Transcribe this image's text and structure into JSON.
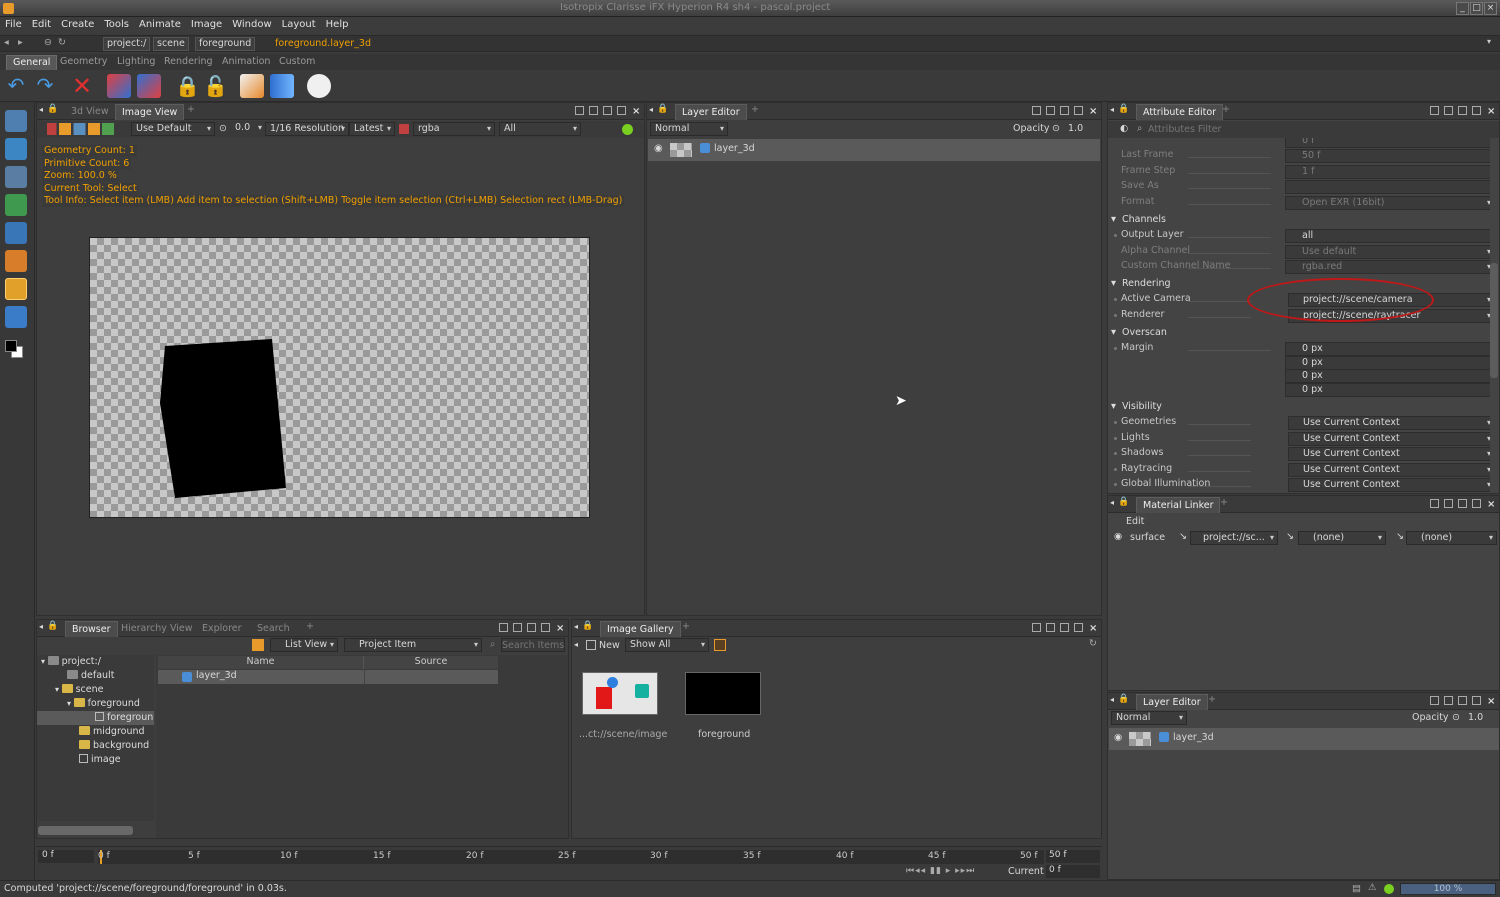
{
  "app": {
    "window_title": "Isotropix Clarisse iFX Hyperion R4 sh4 - pascal.project"
  },
  "menu": [
    "File",
    "Edit",
    "Create",
    "Tools",
    "Animate",
    "Image",
    "Window",
    "Layout",
    "Help"
  ],
  "address": {
    "crumbs": [
      "project:/",
      "scene",
      "foreground"
    ],
    "current": "foreground.layer_3d"
  },
  "shelf_tabs": [
    "General",
    "Geometry",
    "Lighting",
    "Rendering",
    "Animation",
    "Custom"
  ],
  "viewer": {
    "tabs": [
      "3d View",
      "Image View"
    ],
    "display": "Use Default",
    "exposure": "0.0",
    "resolution": "1/16 Resolution",
    "latest": "Latest",
    "channel": "rgba",
    "all": "All",
    "overlay": {
      "geometry_count": "Geometry Count: 1",
      "primitive_count": "Primitive Count: 6",
      "zoom": "Zoom: 100.0 %",
      "current_tool": "Current Tool: Select",
      "tool_info": "Tool Info: Select item (LMB)  Add item to selection (Shift+LMB)  Toggle item selection (Ctrl+LMB)  Selection rect (LMB-Drag)"
    }
  },
  "layer_editor": {
    "tab": "Layer Editor",
    "blend": "Normal",
    "opacity_label": "Opacity",
    "opacity": "1.0",
    "layer": "layer_3d"
  },
  "attribute_editor": {
    "tab": "Attribute Editor",
    "filter_placeholder": "Attributes Filter",
    "partial_top": "0 f",
    "rows_top": [
      {
        "label": "Last Frame",
        "value": "50 f"
      },
      {
        "label": "Frame Step",
        "value": "1 f"
      },
      {
        "label": "Save As",
        "value": ""
      },
      {
        "label": "Format",
        "value": "Open EXR (16bit)"
      }
    ],
    "channels": {
      "title": "Channels",
      "output_layer_label": "Output Layer",
      "output_layer": "all",
      "alpha_label": "Alpha Channel",
      "alpha": "Use default",
      "custom_label": "Custom Channel Name",
      "custom": "rgba.red"
    },
    "rendering": {
      "title": "Rendering",
      "camera_label": "Active Camera",
      "camera": "project://scene/camera",
      "renderer_label": "Renderer",
      "renderer": "project://scene/raytracer"
    },
    "overscan": {
      "title": "Overscan",
      "margin_label": "Margin",
      "margins": [
        "0 px",
        "0 px",
        "0 px",
        "0 px"
      ]
    },
    "visibility": {
      "title": "Visibility",
      "rows": [
        {
          "label": "Geometries",
          "value": "Use Current Context"
        },
        {
          "label": "Lights",
          "value": "Use Current Context"
        },
        {
          "label": "Shadows",
          "value": "Use Current Context"
        },
        {
          "label": "Raytracing",
          "value": "Use Current Context"
        },
        {
          "label": "Global Illumination",
          "value": "Use Current Context"
        }
      ]
    }
  },
  "material_linker": {
    "tab": "Material Linker",
    "edit": "Edit",
    "row": {
      "name": "surface",
      "material": "project://sc...",
      "a": "(none)",
      "b": "(none)"
    }
  },
  "layer_editor2": {
    "tab": "Layer Editor",
    "blend": "Normal",
    "opacity_label": "Opacity",
    "opacity": "1.0",
    "layer": "layer_3d"
  },
  "browser": {
    "tabs": [
      "Browser",
      "Hierarchy View",
      "Explorer",
      "Search"
    ],
    "view": "List View",
    "type": "Project Item",
    "search_placeholder": "Search Items",
    "tree": [
      "project:/",
      "default",
      "scene",
      "foreground",
      "foregroun",
      "midground",
      "background",
      "image"
    ],
    "columns": [
      "Name",
      "Source"
    ],
    "items": [
      "layer_3d"
    ]
  },
  "gallery": {
    "tab": "Image Gallery",
    "new": "New",
    "show": "Show All",
    "thumbs": [
      "...ct://scene/image",
      "foreground"
    ]
  },
  "timeline": {
    "start": "0 f",
    "end": "50 f",
    "ticks": [
      "0 f",
      "5 f",
      "10 f",
      "15 f",
      "20 f",
      "25 f",
      "30 f",
      "35 f",
      "40 f",
      "45 f",
      "50 f"
    ],
    "current_label": "Current",
    "current": "0 f"
  },
  "status": {
    "message": "Computed 'project://scene/foreground/foreground' in 0.03s.",
    "progress": "100 %"
  }
}
